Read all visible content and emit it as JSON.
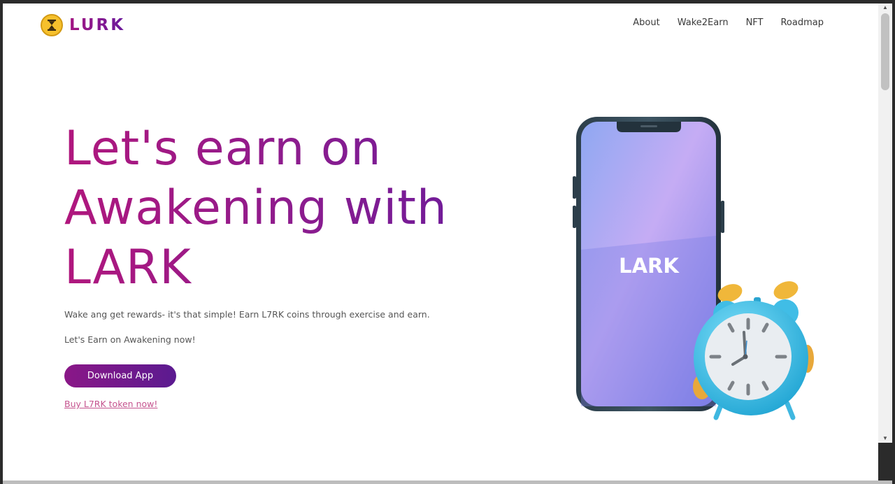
{
  "brand": {
    "name": "LURK",
    "icon": "hourglass-icon"
  },
  "nav": {
    "items": [
      "About",
      "Wake2Earn",
      "NFT",
      "Roadmap"
    ]
  },
  "hero": {
    "title_line1": "Let's earn on",
    "title_line2": "Awakening with",
    "title_line3": "LARK",
    "description": "Wake ang get rewards- it's that simple! Earn L7RK coins through exercise and earn.",
    "subtext": "Let's Earn on Awakening now!",
    "download_label": "Download App",
    "buy_link": "Buy L7RK token now!"
  },
  "phone": {
    "screen_text": "LARK"
  },
  "colors": {
    "brand_magenta": "#a31682",
    "brand_purple": "#661a9c",
    "logo_gold": "#f6c02c",
    "link_pink": "#c5548f",
    "clock_blue": "#3fc0e6"
  }
}
